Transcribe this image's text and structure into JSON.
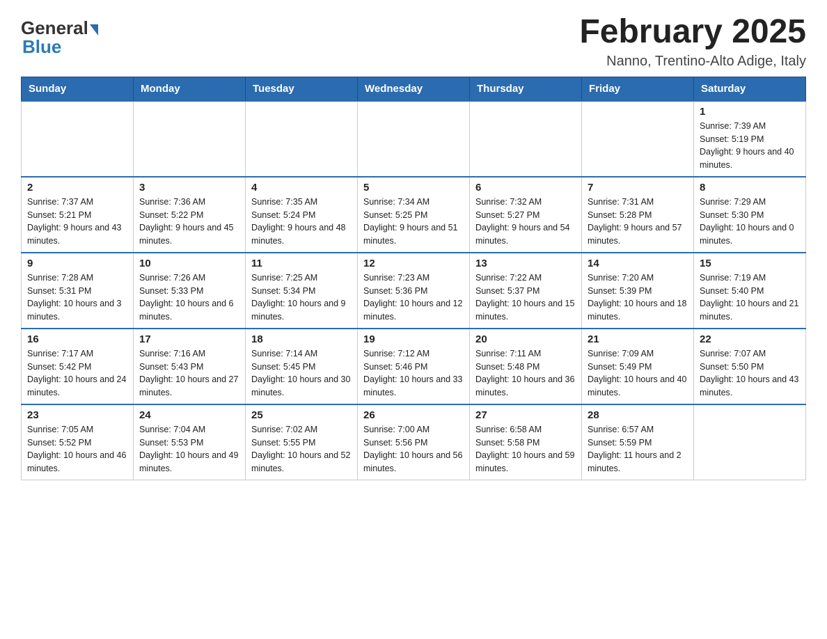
{
  "logo": {
    "general": "General",
    "blue": "Blue"
  },
  "title": "February 2025",
  "subtitle": "Nanno, Trentino-Alto Adige, Italy",
  "weekdays": [
    "Sunday",
    "Monday",
    "Tuesday",
    "Wednesday",
    "Thursday",
    "Friday",
    "Saturday"
  ],
  "weeks": [
    [
      {
        "day": "",
        "info": ""
      },
      {
        "day": "",
        "info": ""
      },
      {
        "day": "",
        "info": ""
      },
      {
        "day": "",
        "info": ""
      },
      {
        "day": "",
        "info": ""
      },
      {
        "day": "",
        "info": ""
      },
      {
        "day": "1",
        "info": "Sunrise: 7:39 AM\nSunset: 5:19 PM\nDaylight: 9 hours and 40 minutes."
      }
    ],
    [
      {
        "day": "2",
        "info": "Sunrise: 7:37 AM\nSunset: 5:21 PM\nDaylight: 9 hours and 43 minutes."
      },
      {
        "day": "3",
        "info": "Sunrise: 7:36 AM\nSunset: 5:22 PM\nDaylight: 9 hours and 45 minutes."
      },
      {
        "day": "4",
        "info": "Sunrise: 7:35 AM\nSunset: 5:24 PM\nDaylight: 9 hours and 48 minutes."
      },
      {
        "day": "5",
        "info": "Sunrise: 7:34 AM\nSunset: 5:25 PM\nDaylight: 9 hours and 51 minutes."
      },
      {
        "day": "6",
        "info": "Sunrise: 7:32 AM\nSunset: 5:27 PM\nDaylight: 9 hours and 54 minutes."
      },
      {
        "day": "7",
        "info": "Sunrise: 7:31 AM\nSunset: 5:28 PM\nDaylight: 9 hours and 57 minutes."
      },
      {
        "day": "8",
        "info": "Sunrise: 7:29 AM\nSunset: 5:30 PM\nDaylight: 10 hours and 0 minutes."
      }
    ],
    [
      {
        "day": "9",
        "info": "Sunrise: 7:28 AM\nSunset: 5:31 PM\nDaylight: 10 hours and 3 minutes."
      },
      {
        "day": "10",
        "info": "Sunrise: 7:26 AM\nSunset: 5:33 PM\nDaylight: 10 hours and 6 minutes."
      },
      {
        "day": "11",
        "info": "Sunrise: 7:25 AM\nSunset: 5:34 PM\nDaylight: 10 hours and 9 minutes."
      },
      {
        "day": "12",
        "info": "Sunrise: 7:23 AM\nSunset: 5:36 PM\nDaylight: 10 hours and 12 minutes."
      },
      {
        "day": "13",
        "info": "Sunrise: 7:22 AM\nSunset: 5:37 PM\nDaylight: 10 hours and 15 minutes."
      },
      {
        "day": "14",
        "info": "Sunrise: 7:20 AM\nSunset: 5:39 PM\nDaylight: 10 hours and 18 minutes."
      },
      {
        "day": "15",
        "info": "Sunrise: 7:19 AM\nSunset: 5:40 PM\nDaylight: 10 hours and 21 minutes."
      }
    ],
    [
      {
        "day": "16",
        "info": "Sunrise: 7:17 AM\nSunset: 5:42 PM\nDaylight: 10 hours and 24 minutes."
      },
      {
        "day": "17",
        "info": "Sunrise: 7:16 AM\nSunset: 5:43 PM\nDaylight: 10 hours and 27 minutes."
      },
      {
        "day": "18",
        "info": "Sunrise: 7:14 AM\nSunset: 5:45 PM\nDaylight: 10 hours and 30 minutes."
      },
      {
        "day": "19",
        "info": "Sunrise: 7:12 AM\nSunset: 5:46 PM\nDaylight: 10 hours and 33 minutes."
      },
      {
        "day": "20",
        "info": "Sunrise: 7:11 AM\nSunset: 5:48 PM\nDaylight: 10 hours and 36 minutes."
      },
      {
        "day": "21",
        "info": "Sunrise: 7:09 AM\nSunset: 5:49 PM\nDaylight: 10 hours and 40 minutes."
      },
      {
        "day": "22",
        "info": "Sunrise: 7:07 AM\nSunset: 5:50 PM\nDaylight: 10 hours and 43 minutes."
      }
    ],
    [
      {
        "day": "23",
        "info": "Sunrise: 7:05 AM\nSunset: 5:52 PM\nDaylight: 10 hours and 46 minutes."
      },
      {
        "day": "24",
        "info": "Sunrise: 7:04 AM\nSunset: 5:53 PM\nDaylight: 10 hours and 49 minutes."
      },
      {
        "day": "25",
        "info": "Sunrise: 7:02 AM\nSunset: 5:55 PM\nDaylight: 10 hours and 52 minutes."
      },
      {
        "day": "26",
        "info": "Sunrise: 7:00 AM\nSunset: 5:56 PM\nDaylight: 10 hours and 56 minutes."
      },
      {
        "day": "27",
        "info": "Sunrise: 6:58 AM\nSunset: 5:58 PM\nDaylight: 10 hours and 59 minutes."
      },
      {
        "day": "28",
        "info": "Sunrise: 6:57 AM\nSunset: 5:59 PM\nDaylight: 11 hours and 2 minutes."
      },
      {
        "day": "",
        "info": ""
      }
    ]
  ]
}
